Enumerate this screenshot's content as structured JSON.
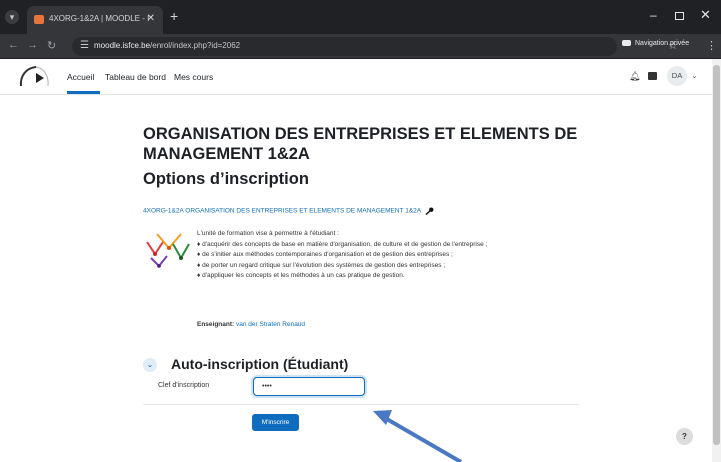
{
  "browser": {
    "tab_title": "4XORG-1&2A | MOODLE - ISF…",
    "url_host": "moodle.isfce.be",
    "url_path": "/enrol/index.php?id=2062",
    "incognito_label": "Navigation privée"
  },
  "navbar": {
    "items": [
      "Accueil",
      "Tableau de bord",
      "Mes cours"
    ],
    "user_initials": "DA"
  },
  "course": {
    "title": "ORGANISATION DES ENTREPRISES ET ELEMENTS DE MANAGEMENT 1&2A",
    "page_heading": "Options d’inscription",
    "link_text": "4XORG-1&2A ORGANISATION DES ENTREPRISES ET ELEMENTS DE MANAGEMENT 1&2A",
    "summary_intro": "L'unité de formation vise à permettre à l'étudiant :",
    "summary_points": [
      "d'acquérir des concepts de base en matière d'organisation, de culture et de gestion de l'entreprise ;",
      "de s'initier aux méthodes contemporaines d'organisation et de gestion des entreprises ;",
      "de porter un regard critique sur l'évolution des systèmes de gestion des entreprises ;",
      "d'appliquer les concepts et les méthodes à un cas pratique de gestion."
    ],
    "teacher_label": "Enseignant:",
    "teacher_name": "van der Straten Renaud"
  },
  "enrol": {
    "section_title": "Auto-inscription (Étudiant)",
    "key_label": "Clef d'inscription",
    "key_value": "••••",
    "submit_label": "M'inscrire"
  },
  "help_label": "?",
  "colors": {
    "primary": "#0f6cbf",
    "arrow": "#4a78c2"
  }
}
